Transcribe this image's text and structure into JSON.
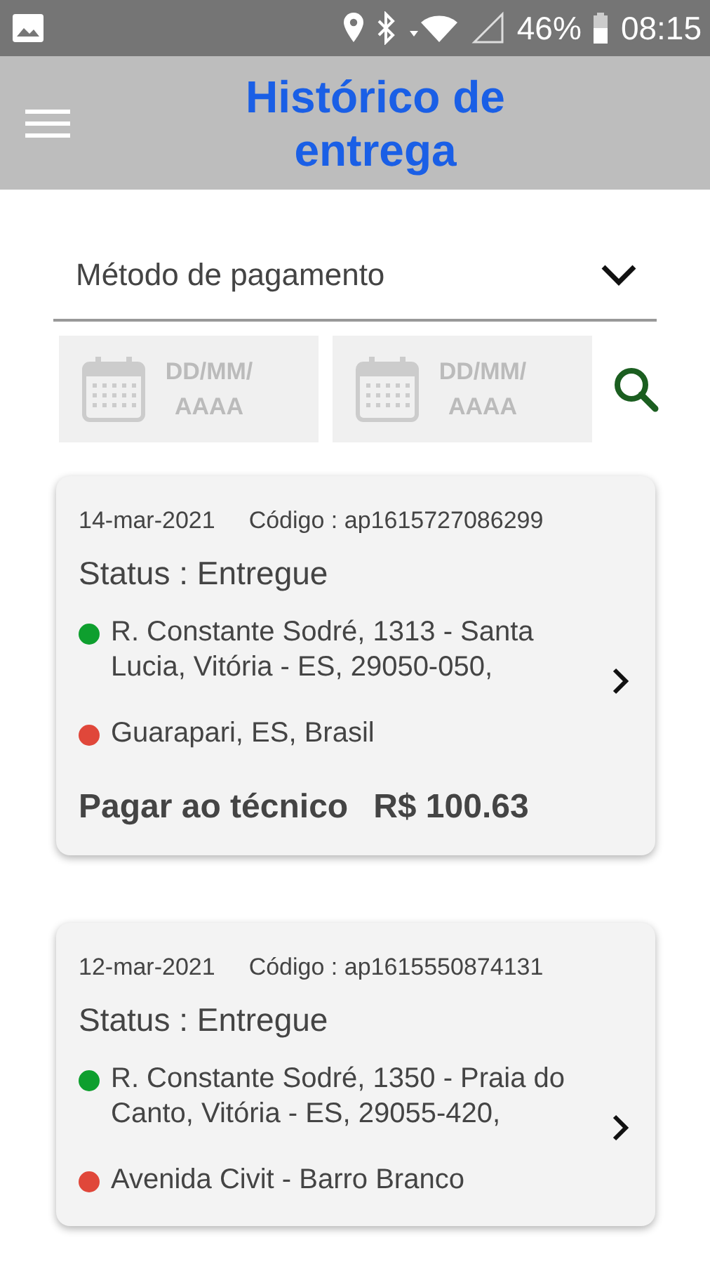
{
  "status_bar": {
    "battery": "46%",
    "time": "08:15"
  },
  "app_bar": {
    "title": "Histórico de entrega"
  },
  "filter": {
    "payment_method": "Método de pagamento",
    "date_from": {
      "placeholder": "DD/MM/AAAA"
    },
    "date_to": {
      "placeholder": "DD/MM/AAAA"
    }
  },
  "deliveries": [
    {
      "date": "14-mar-2021",
      "code": "Código : ap1615727086299",
      "status": "Status : Entregue",
      "stops": [
        {
          "address": "R. Constante Sodré, 1313 - Santa Lucia, Vitória - ES, 29050-050,",
          "color": "#0e9f2e"
        },
        {
          "address": "Guarapari, ES, Brasil",
          "color": "#e0473a"
        }
      ],
      "payment": "Pagar ao técnico",
      "amount": "R$ 100.63"
    },
    {
      "date": "12-mar-2021",
      "code": "Código : ap1615550874131",
      "status": "Status : Entregue",
      "stops": [
        {
          "address": "R. Constante Sodré, 1350 - Praia do Canto, Vitória - ES, 29055-420,",
          "color": "#0e9f2e"
        },
        {
          "address": "Avenida Civit - Barro Branco",
          "color": "#e0473a"
        }
      ]
    }
  ]
}
